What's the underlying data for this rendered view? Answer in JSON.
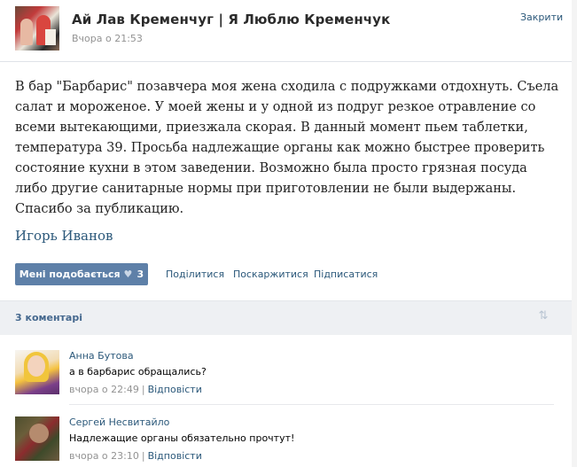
{
  "header": {
    "group_title": "Ай Лав Кременчуг | Я Люблю Кременчук",
    "post_time": "Вчора о 21:53",
    "pin_label": "Закрити"
  },
  "post": {
    "text": "В бар \"Барбарис\" позавчера моя жена сходила с подружками отдохнуть. Съела салат и мороженое. У моей жены и у одной из подруг резкое отравление со всеми вытекающими, приезжала скорая. В данный момент пьем таблетки, температура 39. Просьба надлежащие органы как можно быстрее проверить состояние кухни в этом заведении. Возможно была просто грязная посуда либо другие санитарные нормы при приготовлении не были выдержаны. Спасибо за публикацию.",
    "signer": "Игорь Иванов"
  },
  "actions": {
    "like_label": "Мені подобається",
    "like_count": "3",
    "share_label": "Поділитися",
    "report_label": "Поскаржитися",
    "subscribe_label": "Підписатися"
  },
  "comments_header": {
    "count_label": "3 коментарі",
    "sort_icon": "sort-arrows-icon"
  },
  "comments": [
    {
      "author": "Анна Бутова",
      "text": "а в барбарис обращались?",
      "time": "вчора о 22:49",
      "separator": "|",
      "reply_label": "Відповісти"
    },
    {
      "author": "Сергей Несвитайло",
      "text": "Надлежащие органы обязательно прочтут!",
      "time": "вчора о 23:10",
      "separator": "|",
      "reply_label": "Відповісти"
    }
  ],
  "colors": {
    "link": "#2b587a",
    "like_button": "#5e80a8",
    "comments_bar": "#eef0f3",
    "muted": "#939393"
  }
}
